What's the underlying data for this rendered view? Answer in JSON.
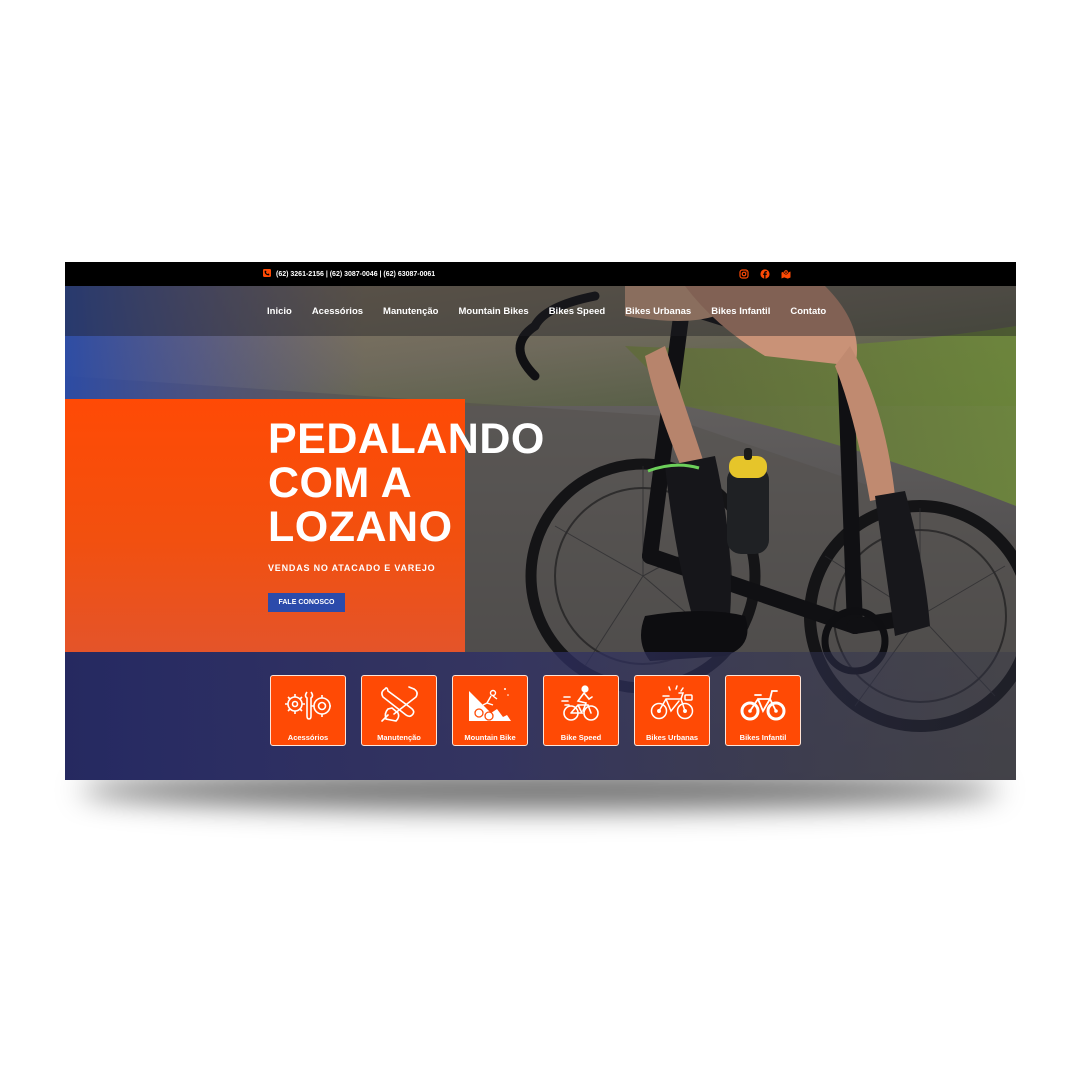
{
  "topbar": {
    "phones": "(62) 3261-2156 | (62) 3087-0046 | (62) 63087-0061",
    "phone_icon": "phone-icon",
    "social_icons": [
      "instagram-icon",
      "facebook-icon",
      "map-icon"
    ]
  },
  "nav": {
    "items": [
      "Inicio",
      "Acessórios",
      "Manutenção",
      "Mountain Bikes",
      "Bikes Speed",
      "Bikes Urbanas",
      "Bikes Infantil",
      "Contato"
    ]
  },
  "hero": {
    "headline": [
      "PEDALANDO",
      "COM A",
      "LOZANO"
    ],
    "subtitle": "VENDAS NO ATACADO E VAREJO",
    "cta_label": "FALE CONOSCO"
  },
  "categories": [
    {
      "label": "Acessórios",
      "icon": "gears-icon"
    },
    {
      "label": "Manutenção",
      "icon": "wrench-hand-icon"
    },
    {
      "label": "Mountain Bike",
      "icon": "mountain-bike-icon"
    },
    {
      "label": "Bike Speed",
      "icon": "speed-cyclist-icon"
    },
    {
      "label": "Bikes Urbanas",
      "icon": "urban-bike-icon"
    },
    {
      "label": "Bikes Infantil",
      "icon": "kids-bike-icon"
    }
  ],
  "colors": {
    "accent": "#ff4a05",
    "button": "#2b4bab",
    "topbar": "#000000"
  }
}
